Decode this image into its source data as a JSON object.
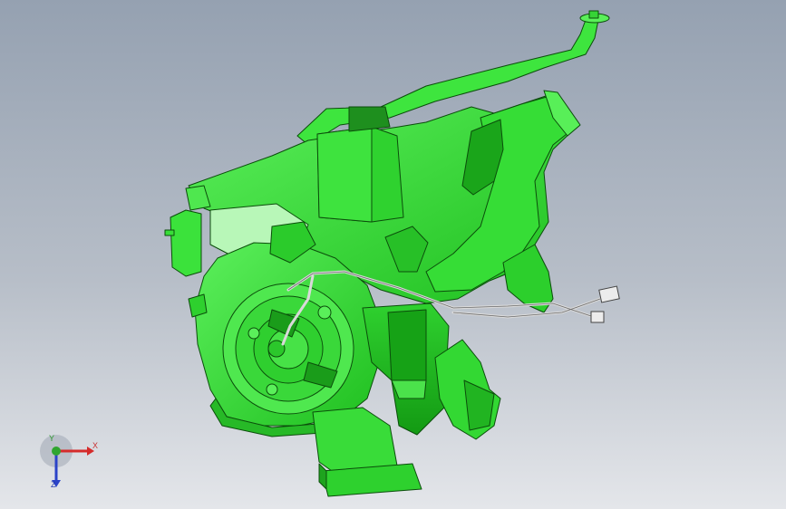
{
  "viewport": {
    "background_top": "#95a1b1",
    "background_bottom": "#e4e6ea",
    "model_color": "#33e033",
    "edge_color": "#0b4d0b"
  },
  "model": {
    "description_icon": "hvac-blower-housing-model",
    "cable_color": "#f2f2f2"
  },
  "triad": {
    "x_label": "X",
    "y_label": "Y",
    "z_label": "Z",
    "x_color": "#d52b2b",
    "y_color": "#2ea52e",
    "z_color": "#2b43c8"
  }
}
